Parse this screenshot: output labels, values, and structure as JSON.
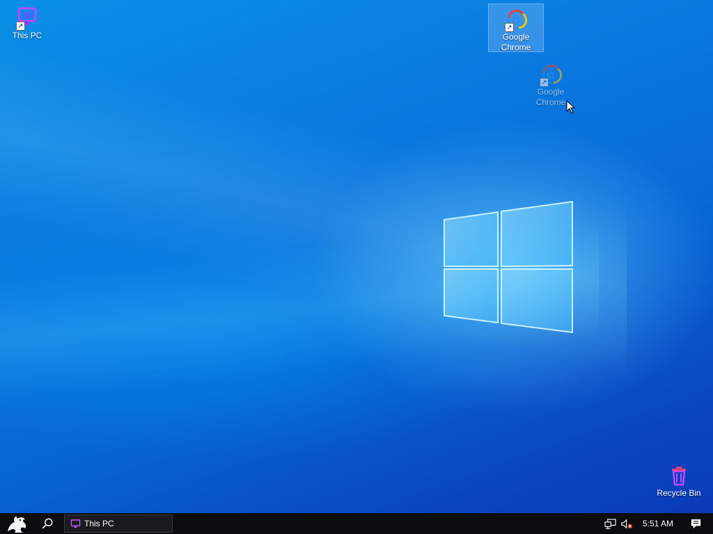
{
  "desktop": {
    "icons": [
      {
        "label": "This PC",
        "icon": "this-pc-icon"
      },
      {
        "label_line1": "Google",
        "label_line2": "Chrome",
        "icon": "chrome-icon",
        "state": "selected"
      },
      {
        "label_line1": "Google",
        "label_line2": "Chrome",
        "icon": "chrome-icon",
        "state": "dragging"
      },
      {
        "label": "Recycle Bin",
        "icon": "recycle-bin-icon"
      }
    ]
  },
  "taskbar": {
    "start_icon": "dragon-start-icon",
    "search_icon": "search-icon",
    "running_app": {
      "label": "This PC",
      "icon": "this-pc-icon"
    },
    "tray": {
      "network_icon": "network-icon",
      "volume_icon": "volume-muted-icon",
      "time": "5:51 AM",
      "notification_icon": "action-center-icon"
    }
  },
  "colors": {
    "taskbar_bg": "#0c0c0f",
    "desktop_bg": "#0a7be0",
    "icon_accent": "#b64cff"
  }
}
